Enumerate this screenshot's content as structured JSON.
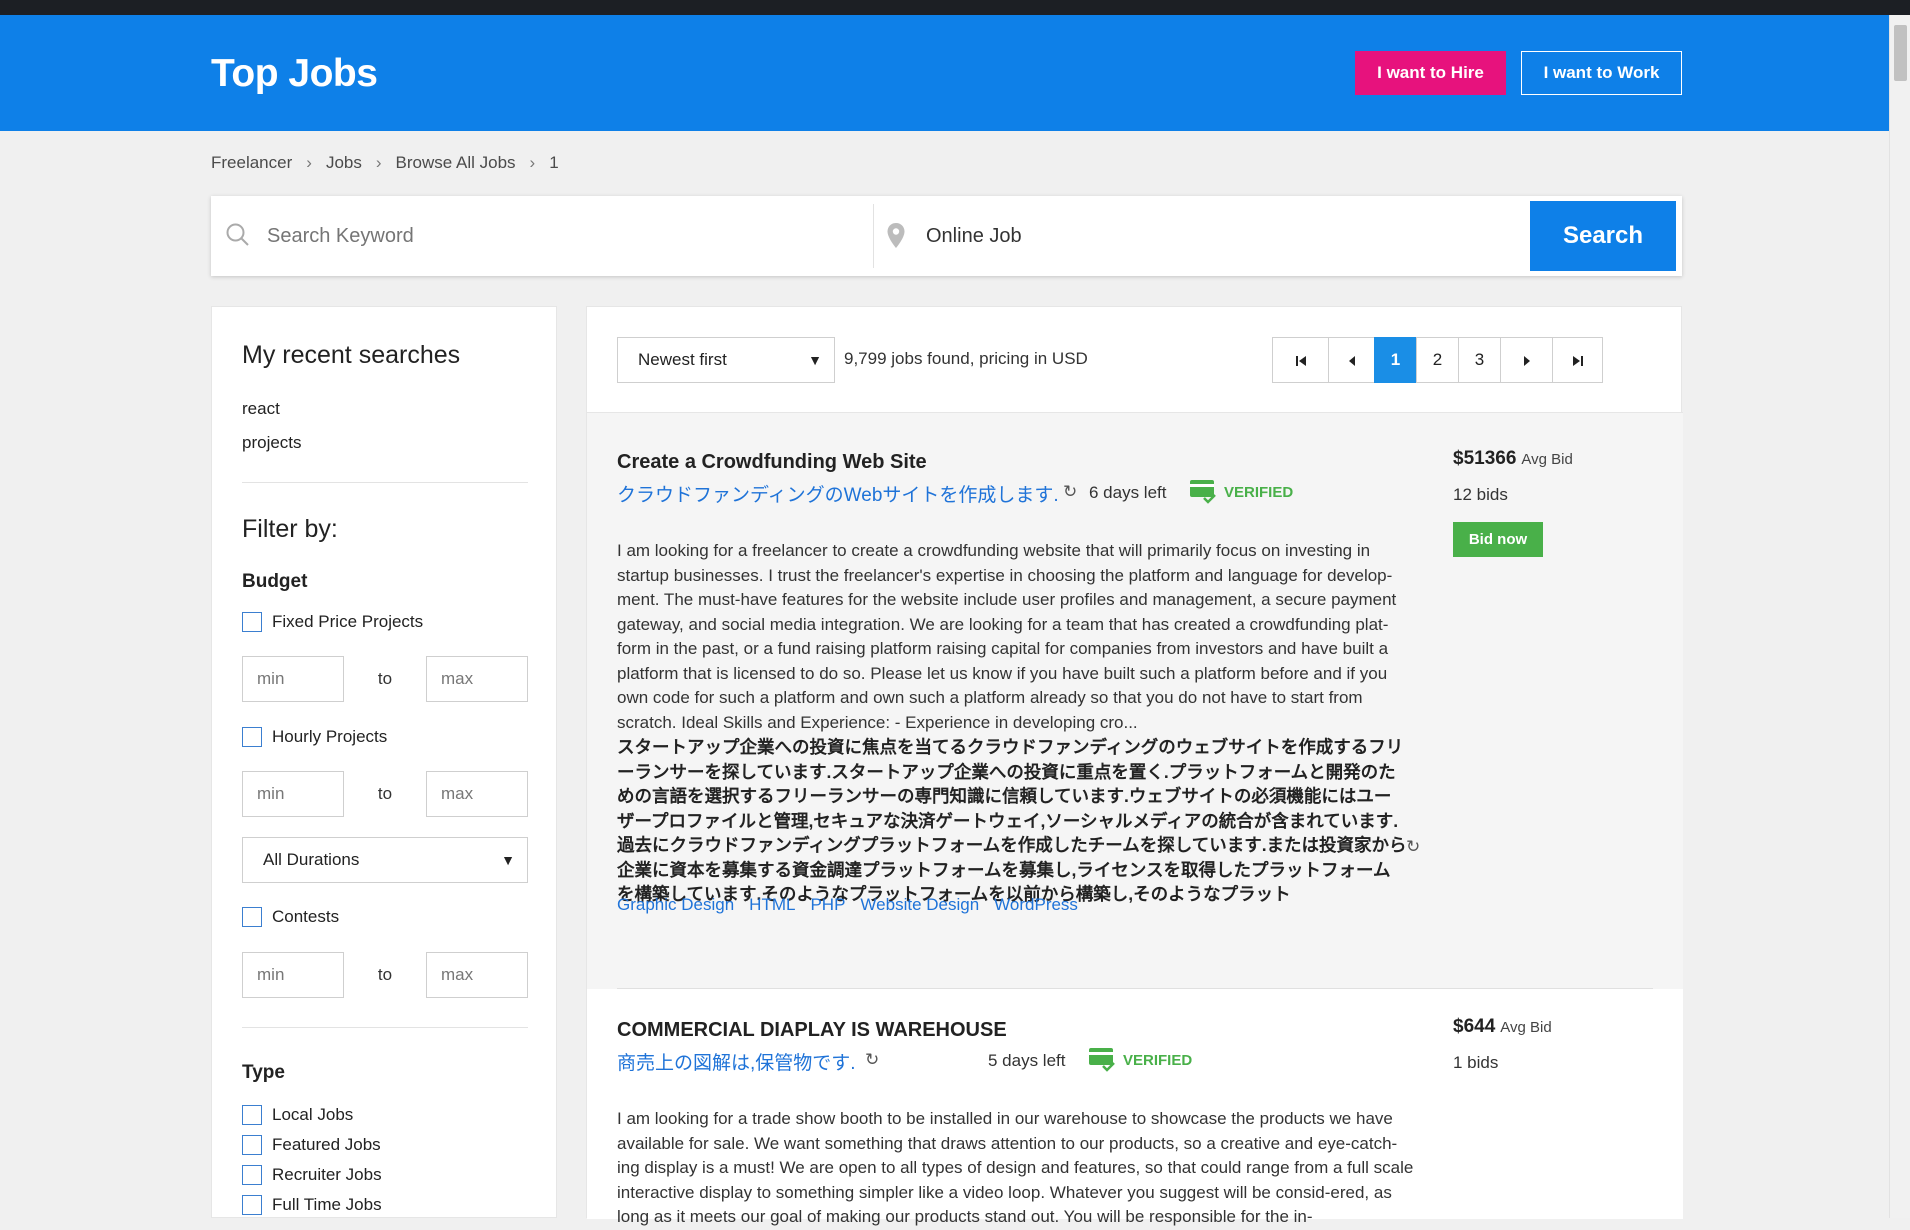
{
  "header": {
    "logo": "Top Jobs",
    "hire": "I want to Hire",
    "work": "I want to Work"
  },
  "breadcrumb": [
    "Freelancer",
    "Jobs",
    "Browse All Jobs",
    "1"
  ],
  "search": {
    "keyword_placeholder": "Search Keyword",
    "location_value": "Online Job",
    "button": "Search"
  },
  "sidebar": {
    "recent_title": "My recent searches",
    "recent": [
      "react",
      "projects"
    ],
    "filter_title": "Filter by:",
    "budget_title": "Budget",
    "fixed_label": "Fixed Price Projects",
    "hourly_label": "Hourly Projects",
    "contests_label": "Contests",
    "min": "min",
    "to": "to",
    "max": "max",
    "duration": "All Durations",
    "type_title": "Type",
    "types": [
      "Local Jobs",
      "Featured Jobs",
      "Recruiter Jobs",
      "Full Time Jobs"
    ]
  },
  "toolbar": {
    "sort": "Newest first",
    "found": "9,799 jobs found, pricing in USD",
    "pages": [
      "1",
      "2",
      "3"
    ]
  },
  "jobs": [
    {
      "title": "Create a Crowdfunding Web Site",
      "jp_title": "クラウドファンディングのWebサイトを作成します.",
      "days_left": "6 days left",
      "verified": "VERIFIED",
      "desc": "I am looking for a freelancer to create a crowdfunding website that will primarily focus on investing in startup businesses. I trust the freelancer's expertise in choosing the platform and language for develop-ment. The must-have features for the website include user profiles and management, a secure payment gateway, and social media integration. We are looking for a team that has created a crowdfunding plat-form in the past, or a fund raising platform raising capital for companies from investors and have built a platform that is licensed to do so. Please let us know if you have built such a platform before and if you own code for such a platform and own such a platform already so that you do not have to start from scratch. Ideal Skills and Experience: - Experience in developing cro...",
      "jp_desc": "スタートアップ企業への投資に焦点を当てるクラウドファンディングのウェブサイトを作成するフリーランサーを探しています.スタートアップ企業への投資に重点を置く.プラットフォームと開発のための言語を選択するフリーランサーの専門知識に信頼しています.ウェブサイトの必須機能にはユーザープロファイルと管理,セキュアな決済ゲートウェイ,ソーシャルメディアの統合が含まれています.過去にクラウドファンディングプラットフォームを作成したチームを探しています.または投資家から企業に資本を募集する資金調達プラットフォームを募集し,ライセンスを取得したプラットフォームを構築しています.そのようなプラットフォームを以前から構築し,そのようなプラット",
      "tags": [
        "Graphic Design",
        "HTML",
        "PHP",
        "Website Design",
        "WordPress"
      ],
      "bid": "$51366",
      "avg": "Avg Bid",
      "bids": "12 bids",
      "bid_now": "Bid now"
    },
    {
      "title": "COMMERCIAL DIAPLAY IS WAREHOUSE",
      "jp_title": "商売上の図解は,保管物です.",
      "days_left": "5 days left",
      "verified": "VERIFIED",
      "desc": "I am looking for a trade show booth to be installed in our warehouse to showcase the products we have available for sale. We want something that draws attention to our products, so a creative and eye-catch-ing display is a must! We are open to all types of design and features, so that could range from a full scale interactive display to something simpler like a video loop. Whatever you suggest will be consid-ered, as long as it meets our goal of making our products stand out. You will be responsible for the in-",
      "bid": "$644",
      "avg": "Avg Bid",
      "bids": "1 bids"
    }
  ],
  "colors": {
    "header": "#0e80e8",
    "hire": "#e7127d",
    "verified": "#49b049",
    "link": "#1f73d8"
  }
}
